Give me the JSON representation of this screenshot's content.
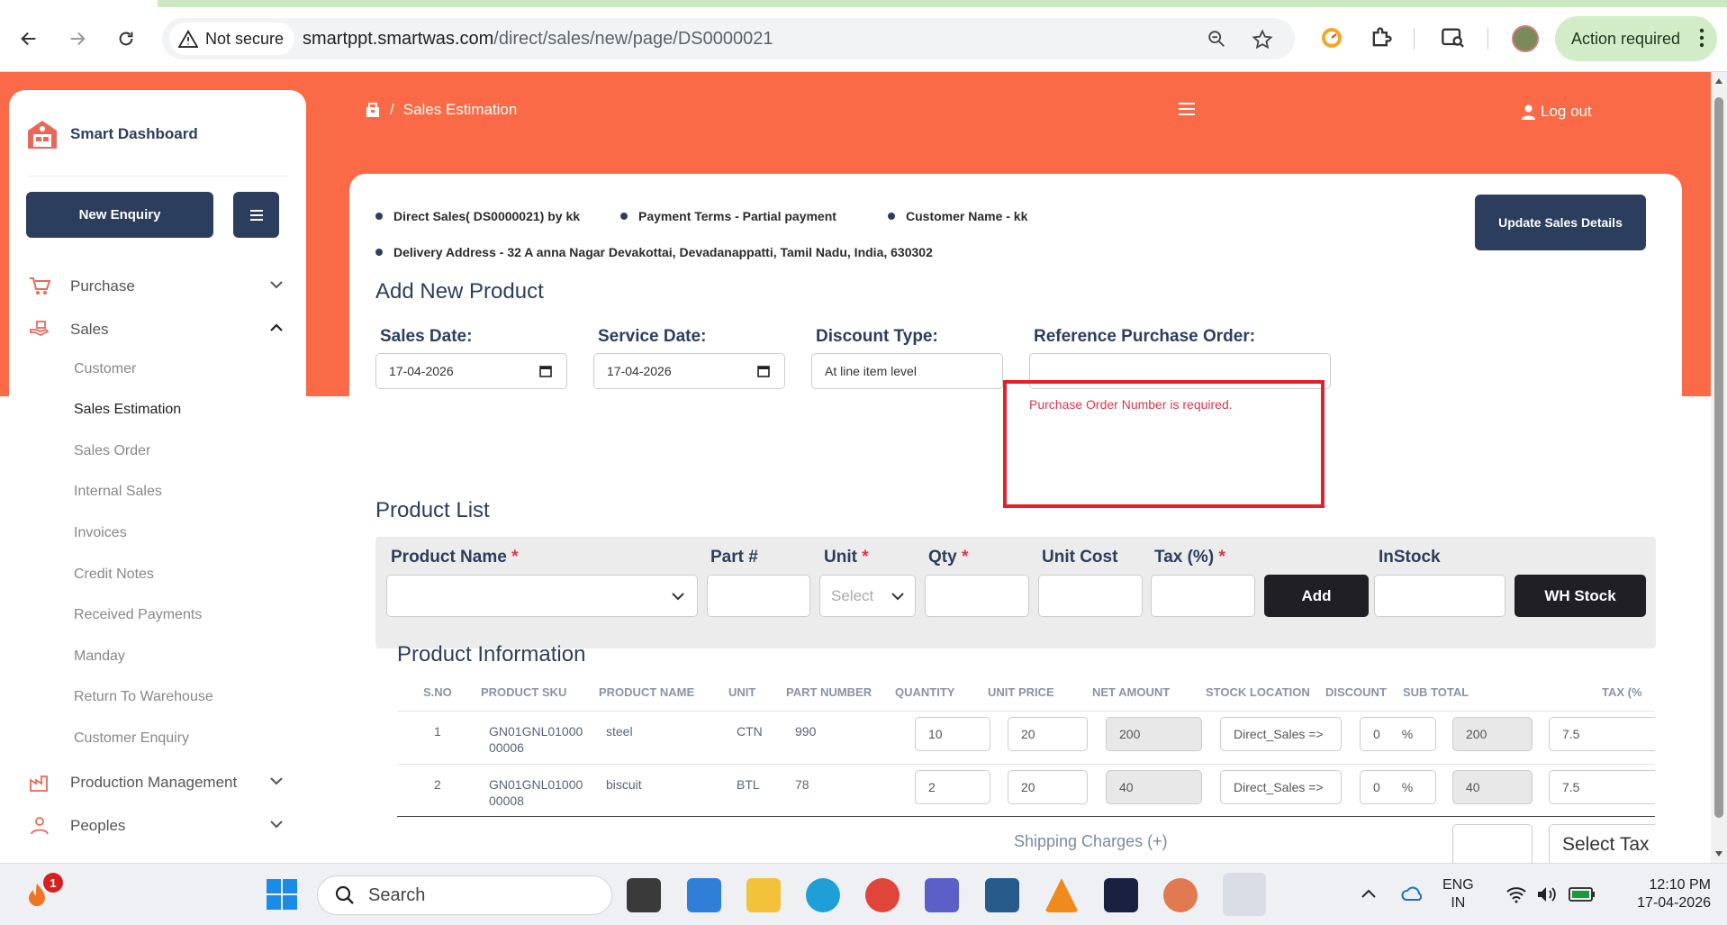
{
  "browser": {
    "security_label": "Not secure",
    "url_domain": "smartppt.smartwas.com",
    "url_path": "/direct/sales/new/page/DS0000021",
    "action_required": "Action required"
  },
  "sidebar": {
    "brand": "Smart Dashboard",
    "new_enquiry": "New Enquiry",
    "purchase": "Purchase",
    "sales": "Sales",
    "sub_items": [
      "Customer",
      "Sales Estimation",
      "Sales Order",
      "Internal Sales",
      "Invoices",
      "Credit Notes",
      "Received Payments",
      "Manday",
      "Return To Warehouse",
      "Customer Enquiry"
    ],
    "production": "Production Management",
    "peoples": "Peoples"
  },
  "header": {
    "breadcrumb_sep": "/",
    "breadcrumb_page": "Sales Estimation",
    "logout": "Log out"
  },
  "summary": {
    "direct_sales": "Direct Sales( DS0000021) by kk",
    "payment_terms": "Payment Terms - Partial payment",
    "customer_name": "Customer Name - kk",
    "delivery_address": "Delivery Address - 32 A anna Nagar Devakottai, Devadanappatti, Tamil Nadu, India, 630302",
    "update_button": "Update Sales Details"
  },
  "add_product": {
    "title": "Add New Product",
    "sales_date_label": "Sales Date:",
    "sales_date": "17-04-2026",
    "service_date_label": "Service Date:",
    "service_date": "17-04-2026",
    "discount_type_label": "Discount Type:",
    "discount_type": "At line item level",
    "ref_po_label": "Reference Purchase Order:",
    "ref_po_value": "",
    "ref_po_error": "Purchase Order Number is required."
  },
  "product_list": {
    "title": "Product List",
    "product_name": "Product Name",
    "part": "Part #",
    "unit": "Unit",
    "unit_placeholder": "Select",
    "qty": "Qty",
    "unit_cost": "Unit Cost",
    "tax": "Tax (%)",
    "instock": "InStock",
    "add_button": "Add",
    "wh_stock_button": "WH Stock",
    "required_mark": "*"
  },
  "product_info": {
    "title": "Product Information",
    "columns": [
      "S.NO",
      "PRODUCT SKU",
      "PRODUCT NAME",
      "UNIT",
      "PART NUMBER",
      "QUANTITY",
      "UNIT PRICE",
      "NET AMOUNT",
      "STOCK LOCATION",
      "DISCOUNT",
      "SUB TOTAL",
      "TAX (%"
    ],
    "rows": [
      {
        "sno": "1",
        "sku_line1": "GN01GNL01000",
        "sku_line2": "00006",
        "name": "steel",
        "unit": "CTN",
        "part": "990",
        "qty": "10",
        "price": "20",
        "net": "200",
        "location": "Direct_Sales =>",
        "discount": "0",
        "discount_unit": "%",
        "subtotal": "200",
        "tax": "7.5"
      },
      {
        "sno": "2",
        "sku_line1": "GN01GNL01000",
        "sku_line2": "00008",
        "name": "biscuit",
        "unit": "BTL",
        "part": "78",
        "qty": "2",
        "price": "20",
        "net": "40",
        "location": "Direct_Sales =>",
        "discount": "0",
        "discount_unit": "%",
        "subtotal": "40",
        "tax": "7.5"
      }
    ],
    "shipping_label": "Shipping Charges (+)",
    "select_tax": "Select Tax"
  },
  "taskbar": {
    "notif_count": "1",
    "search_placeholder": "Search",
    "lang_line1": "ENG",
    "lang_line2": "IN",
    "time": "12:10 PM",
    "date": "17-04-2026"
  },
  "colors": {
    "accent": "#FA6A47",
    "navy": "#2C3E5E",
    "error": "#E0334F",
    "highlight": "#E3202B"
  }
}
